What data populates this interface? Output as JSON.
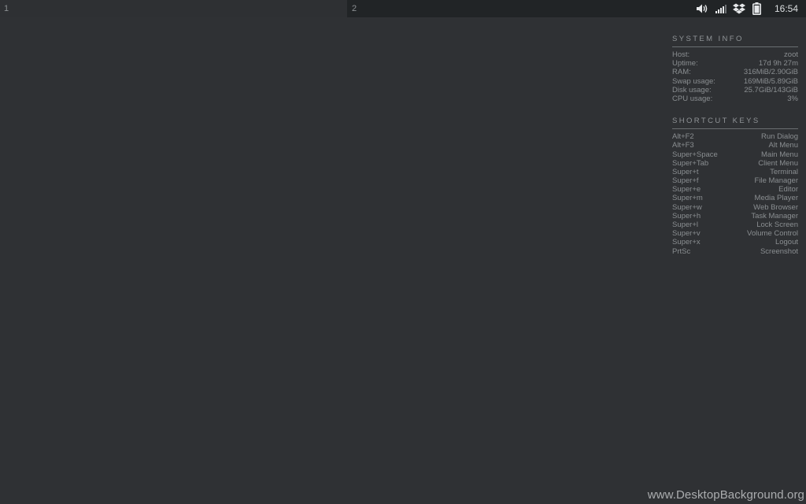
{
  "panel": {
    "workspaces": [
      {
        "label": "1"
      },
      {
        "label": "2"
      }
    ],
    "tray": {
      "icons": [
        "volume-icon",
        "signal-icon",
        "dropbox-icon",
        "battery-icon"
      ]
    },
    "clock": "16:54"
  },
  "conky": {
    "system_info": {
      "title": "SYSTEM INFO",
      "rows": [
        {
          "key": "Host:",
          "value": "zoot"
        },
        {
          "key": "Uptime:",
          "value": "17d 9h 27m"
        },
        {
          "key": "RAM:",
          "value": "316MiB/2.90GiB"
        },
        {
          "key": "Swap usage:",
          "value": "169MiB/5.89GiB"
        },
        {
          "key": "Disk usage:",
          "value": "25.7GiB/143GiB"
        },
        {
          "key": "CPU usage:",
          "value": "3%"
        }
      ]
    },
    "shortcut_keys": {
      "title": "SHORTCUT KEYS",
      "rows": [
        {
          "key": "Alt+F2",
          "value": "Run Dialog"
        },
        {
          "key": "Alt+F3",
          "value": "Alt Menu"
        },
        {
          "key": "Super+Space",
          "value": "Main Menu"
        },
        {
          "key": "Super+Tab",
          "value": "Client Menu"
        },
        {
          "key": "Super+t",
          "value": "Terminal"
        },
        {
          "key": "Super+f",
          "value": "File Manager"
        },
        {
          "key": "Super+e",
          "value": "Editor"
        },
        {
          "key": "Super+m",
          "value": "Media Player"
        },
        {
          "key": "Super+w",
          "value": "Web Browser"
        },
        {
          "key": "Super+h",
          "value": "Task Manager"
        },
        {
          "key": "Super+l",
          "value": "Lock Screen"
        },
        {
          "key": "Super+v",
          "value": "Volume Control"
        },
        {
          "key": "Super+x",
          "value": "Logout"
        },
        {
          "key": "PrtSc",
          "value": "Screenshot"
        }
      ]
    }
  },
  "watermark": "www.DesktopBackground.org",
  "colors": {
    "desktop_bg": "#2f3134",
    "panel_bg": "#212426",
    "active_workspace_bg": "#2e3033",
    "text": "#8a8e91",
    "clock_text": "#dcdfe1"
  }
}
